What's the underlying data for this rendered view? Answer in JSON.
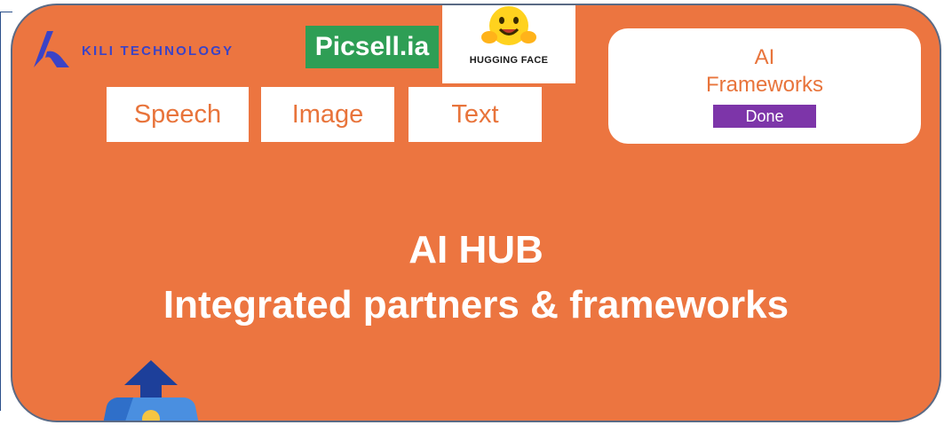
{
  "partners": {
    "kili": {
      "name": "KILI TECHNOLOGY",
      "icon": "kili-logo-icon",
      "color": "#3b43c6"
    },
    "picsell": {
      "name": "Picsell.ia",
      "color": "#2e9e55"
    },
    "hugging_face": {
      "name": "HUGGING FACE",
      "icon": "hugging-face-emoji-icon"
    }
  },
  "modalities": [
    "Speech",
    "Image",
    "Text"
  ],
  "ai_frameworks": {
    "line1": "AI",
    "line2": "Frameworks",
    "status": "Done",
    "status_color": "#7d35a9"
  },
  "hub": {
    "title": "AI HUB",
    "subtitle": "Integrated partners & frameworks",
    "background_color": "#ec7540"
  },
  "robot": {
    "icon": "upload-robot-icon"
  }
}
